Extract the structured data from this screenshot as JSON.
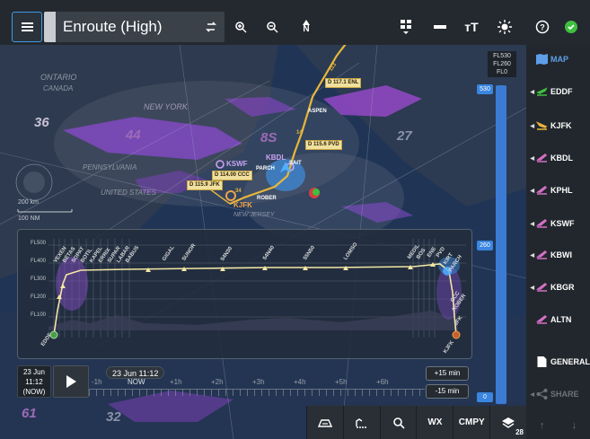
{
  "toolbar": {
    "chart_title": "Enroute (High)",
    "icons": [
      "menu-icon",
      "swap-icon",
      "zoom-in-icon",
      "zoom-out-icon",
      "north-up-icon",
      "layers-menu-icon",
      "line-weight-icon",
      "text-size-icon",
      "brightness-icon",
      "help-icon",
      "status-ok-icon"
    ],
    "north_label": "N",
    "text_size_label": "тT",
    "help_label": "?",
    "status_color": "#3fbf3f"
  },
  "map": {
    "regions": [
      "ONTARIO",
      "CANADA",
      "NEW YORK",
      "PENNSYLVANIA",
      "UNITED STATES",
      "NEW JERSEY"
    ],
    "sectors": [
      "36",
      "44",
      "8S",
      "27",
      "61",
      "32"
    ],
    "scale": {
      "distance_km": "200 km",
      "distance_nm": "100 NM"
    },
    "airports": [
      "KSWF",
      "KBDL",
      "KJFK"
    ],
    "navaids": [
      "D 117.1 ENL",
      "D 115.6 PVD",
      "D 114.00 CCC",
      "D 115.9 JFK"
    ],
    "waypoints": [
      "ASPEN",
      "PARCH",
      "ROBER",
      "SAIT"
    ],
    "fl_readout": [
      "FL530",
      "FL260",
      "FL0"
    ],
    "altitude_markers": {
      "top": "530",
      "middle": "260",
      "bottom": "0"
    },
    "numbers": [
      "113",
      "34",
      "14"
    ]
  },
  "profile": {
    "flight_levels": [
      "FL500",
      "FL400",
      "FL300",
      "FL200",
      "FL100"
    ],
    "left_waypoints": [
      "EDDF",
      "VEXEN",
      "BETAS",
      "SOPAT",
      "BOTIL",
      "KAPEL",
      "ERRIX",
      "SUPAR",
      "LABAR",
      "BABUS"
    ],
    "mid_waypoints": [
      "GIGAL",
      "SUNOR",
      "54N30",
      "54N40",
      "55N50",
      "LOMSO"
    ],
    "right_waypoints": [
      "MEDIL",
      "BOS",
      "ENE",
      "PVD",
      "KIRT",
      "PARCH",
      "CCC",
      "ROBER",
      "JFK",
      "KJFK"
    ]
  },
  "timebar": {
    "date": "23 Jun",
    "time": "11:12",
    "now": "(NOW)",
    "pill": "23 Jun 11:12",
    "labels": [
      "-1h",
      "NOW",
      "+1h",
      "+2h",
      "+3h",
      "+4h",
      "+5h",
      "+6h"
    ],
    "plus": "+15 min",
    "minus": "-15 min"
  },
  "bottom": {
    "wx": "WX",
    "cmpy": "CMPY",
    "layers_count": "28"
  },
  "sidebar": {
    "map": "MAP",
    "airports": [
      {
        "code": "EDDF",
        "color": "#3fbf3f"
      },
      {
        "code": "KJFK",
        "color": "#e9b23c"
      },
      {
        "code": "KBDL",
        "color": "#d66fc6"
      },
      {
        "code": "KPHL",
        "color": "#d66fc6"
      },
      {
        "code": "KSWF",
        "color": "#d66fc6"
      },
      {
        "code": "KBWI",
        "color": "#d66fc6"
      },
      {
        "code": "KBGR",
        "color": "#d66fc6"
      }
    ],
    "altn": "ALTN",
    "general": "GENERAL",
    "share": "SHARE"
  }
}
